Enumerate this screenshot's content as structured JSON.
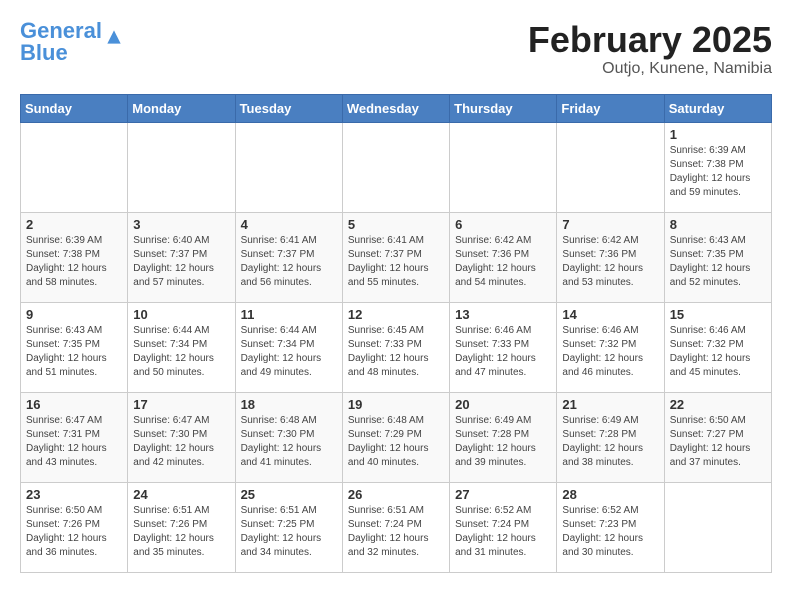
{
  "header": {
    "logo_general": "General",
    "logo_blue": "Blue",
    "month_title": "February 2025",
    "location": "Outjo, Kunene, Namibia"
  },
  "weekdays": [
    "Sunday",
    "Monday",
    "Tuesday",
    "Wednesday",
    "Thursday",
    "Friday",
    "Saturday"
  ],
  "weeks": [
    [
      {
        "day": "",
        "empty": true
      },
      {
        "day": "",
        "empty": true
      },
      {
        "day": "",
        "empty": true
      },
      {
        "day": "",
        "empty": true
      },
      {
        "day": "",
        "empty": true
      },
      {
        "day": "",
        "empty": true
      },
      {
        "day": "1",
        "sunrise": "6:39 AM",
        "sunset": "7:38 PM",
        "daylight": "12 hours and 59 minutes."
      }
    ],
    [
      {
        "day": "2",
        "sunrise": "6:39 AM",
        "sunset": "7:38 PM",
        "daylight": "12 hours and 58 minutes."
      },
      {
        "day": "3",
        "sunrise": "6:40 AM",
        "sunset": "7:37 PM",
        "daylight": "12 hours and 57 minutes."
      },
      {
        "day": "4",
        "sunrise": "6:41 AM",
        "sunset": "7:37 PM",
        "daylight": "12 hours and 56 minutes."
      },
      {
        "day": "5",
        "sunrise": "6:41 AM",
        "sunset": "7:37 PM",
        "daylight": "12 hours and 55 minutes."
      },
      {
        "day": "6",
        "sunrise": "6:42 AM",
        "sunset": "7:36 PM",
        "daylight": "12 hours and 54 minutes."
      },
      {
        "day": "7",
        "sunrise": "6:42 AM",
        "sunset": "7:36 PM",
        "daylight": "12 hours and 53 minutes."
      },
      {
        "day": "8",
        "sunrise": "6:43 AM",
        "sunset": "7:35 PM",
        "daylight": "12 hours and 52 minutes."
      }
    ],
    [
      {
        "day": "9",
        "sunrise": "6:43 AM",
        "sunset": "7:35 PM",
        "daylight": "12 hours and 51 minutes."
      },
      {
        "day": "10",
        "sunrise": "6:44 AM",
        "sunset": "7:34 PM",
        "daylight": "12 hours and 50 minutes."
      },
      {
        "day": "11",
        "sunrise": "6:44 AM",
        "sunset": "7:34 PM",
        "daylight": "12 hours and 49 minutes."
      },
      {
        "day": "12",
        "sunrise": "6:45 AM",
        "sunset": "7:33 PM",
        "daylight": "12 hours and 48 minutes."
      },
      {
        "day": "13",
        "sunrise": "6:46 AM",
        "sunset": "7:33 PM",
        "daylight": "12 hours and 47 minutes."
      },
      {
        "day": "14",
        "sunrise": "6:46 AM",
        "sunset": "7:32 PM",
        "daylight": "12 hours and 46 minutes."
      },
      {
        "day": "15",
        "sunrise": "6:46 AM",
        "sunset": "7:32 PM",
        "daylight": "12 hours and 45 minutes."
      }
    ],
    [
      {
        "day": "16",
        "sunrise": "6:47 AM",
        "sunset": "7:31 PM",
        "daylight": "12 hours and 43 minutes."
      },
      {
        "day": "17",
        "sunrise": "6:47 AM",
        "sunset": "7:30 PM",
        "daylight": "12 hours and 42 minutes."
      },
      {
        "day": "18",
        "sunrise": "6:48 AM",
        "sunset": "7:30 PM",
        "daylight": "12 hours and 41 minutes."
      },
      {
        "day": "19",
        "sunrise": "6:48 AM",
        "sunset": "7:29 PM",
        "daylight": "12 hours and 40 minutes."
      },
      {
        "day": "20",
        "sunrise": "6:49 AM",
        "sunset": "7:28 PM",
        "daylight": "12 hours and 39 minutes."
      },
      {
        "day": "21",
        "sunrise": "6:49 AM",
        "sunset": "7:28 PM",
        "daylight": "12 hours and 38 minutes."
      },
      {
        "day": "22",
        "sunrise": "6:50 AM",
        "sunset": "7:27 PM",
        "daylight": "12 hours and 37 minutes."
      }
    ],
    [
      {
        "day": "23",
        "sunrise": "6:50 AM",
        "sunset": "7:26 PM",
        "daylight": "12 hours and 36 minutes."
      },
      {
        "day": "24",
        "sunrise": "6:51 AM",
        "sunset": "7:26 PM",
        "daylight": "12 hours and 35 minutes."
      },
      {
        "day": "25",
        "sunrise": "6:51 AM",
        "sunset": "7:25 PM",
        "daylight": "12 hours and 34 minutes."
      },
      {
        "day": "26",
        "sunrise": "6:51 AM",
        "sunset": "7:24 PM",
        "daylight": "12 hours and 32 minutes."
      },
      {
        "day": "27",
        "sunrise": "6:52 AM",
        "sunset": "7:24 PM",
        "daylight": "12 hours and 31 minutes."
      },
      {
        "day": "28",
        "sunrise": "6:52 AM",
        "sunset": "7:23 PM",
        "daylight": "12 hours and 30 minutes."
      },
      {
        "day": "",
        "empty": true
      }
    ]
  ]
}
